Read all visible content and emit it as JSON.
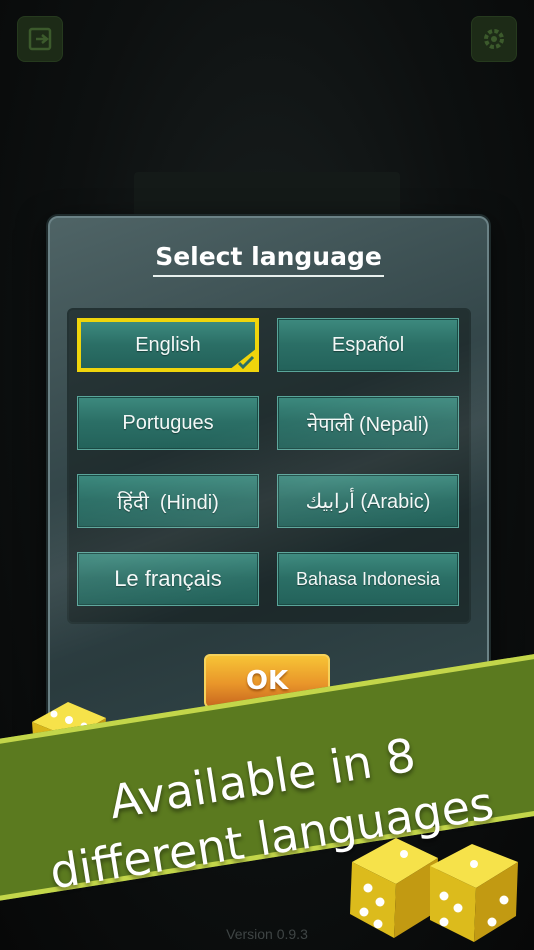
{
  "top_bar": {
    "left_icon": "exit-icon",
    "right_icon": "gear-icon"
  },
  "dialog": {
    "title": "Select language",
    "languages": [
      {
        "label": "English",
        "selected": true
      },
      {
        "label": "Español",
        "selected": false
      },
      {
        "label": "Portugues",
        "selected": false
      },
      {
        "label": "नेपाली (Nepali)",
        "selected": false
      },
      {
        "label": "हिंदी  (Hindi)",
        "selected": false
      },
      {
        "label": "أرابيك (Arabic)",
        "selected": false
      },
      {
        "label": "Le français",
        "selected": false
      },
      {
        "label": "Bahasa Indonesia",
        "selected": false
      }
    ],
    "ok_label": "OK"
  },
  "banner": {
    "line1": "Available in 8",
    "line2": "different languages"
  },
  "version": "Version 0.9.3",
  "colors": {
    "accent_yellow": "#f0d50c",
    "button_teal": "#2b6f66",
    "banner_green": "#5b7a1f",
    "ok_orange": "#e9962a"
  }
}
